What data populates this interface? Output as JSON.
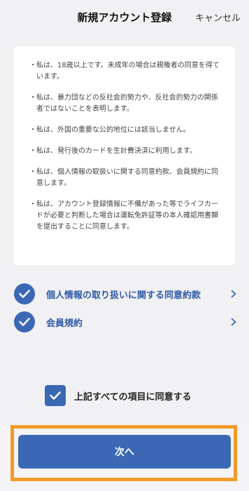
{
  "header": {
    "title": "新規アカウント登録",
    "cancel_label": "キャンセル"
  },
  "terms": {
    "bullet": "・",
    "items": [
      "私は、18歳以上です。未成年の場合は親権者の同意を得ています。",
      "私は、暴力団などの反社会的勢力や、反社会的勢力の関係者ではないことを表明します。",
      "私は、外国の重要な公的地位には該当しません。",
      "私は、発行後のカードを生計費決済に利用します。",
      "私は、個人情報の取扱いに関する同意約款、会員規約に同意します。",
      "私は、アカウント登録情報に不備があった等でライフカードが必要と判断した場合は運転免許証等の本人確認用書類を提出することに同意します。"
    ]
  },
  "agreements": [
    {
      "label": "個人情報の取り扱いに関する同意約款",
      "checked": true
    },
    {
      "label": "会員規約",
      "checked": true
    }
  ],
  "all_agree": {
    "label": "上記すべての項目に同意する",
    "checked": true
  },
  "next_button": {
    "label": "次へ"
  },
  "colors": {
    "accent": "#3a68b4",
    "highlight": "#f39a2b",
    "background": "#f1f1f4"
  }
}
